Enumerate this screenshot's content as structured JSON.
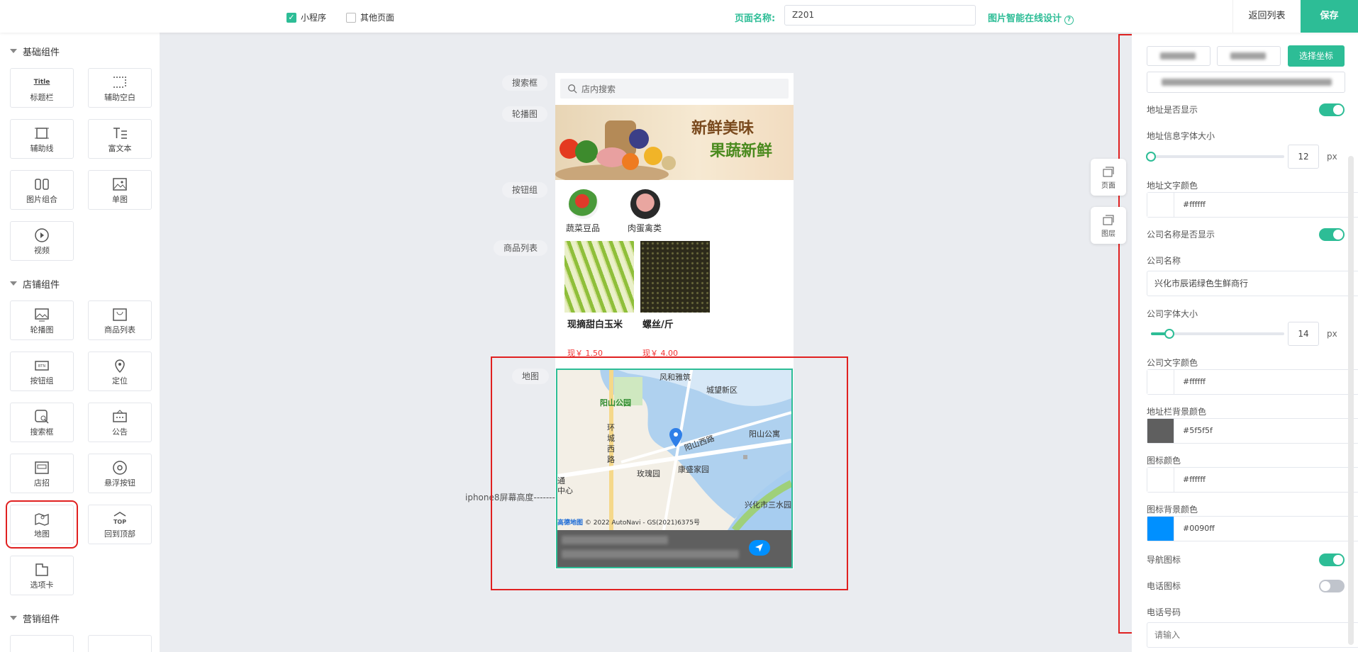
{
  "topbar": {
    "miniprogram_label": "小程序",
    "other_pages_label": "其他页面",
    "page_name_label": "页面名称:",
    "page_name_value": "Z201",
    "ai_design_link": "图片智能在线设计",
    "back_to_list": "返回列表",
    "save": "保存"
  },
  "left_panel": {
    "basic_title": "基础组件",
    "basic_items": [
      {
        "label": "标题栏",
        "icon": "title-icon",
        "icon_text": "Title"
      },
      {
        "label": "辅助空白",
        "icon": "blank-icon"
      },
      {
        "label": "辅助线",
        "icon": "line-icon"
      },
      {
        "label": "富文本",
        "icon": "richtext-icon"
      },
      {
        "label": "图片组合",
        "icon": "image-group-icon"
      },
      {
        "label": "单图",
        "icon": "image-icon"
      },
      {
        "label": "视频",
        "icon": "video-icon"
      }
    ],
    "shop_title": "店铺组件",
    "shop_items": [
      {
        "label": "轮播图",
        "icon": "carousel-icon"
      },
      {
        "label": "商品列表",
        "icon": "goods-list-icon"
      },
      {
        "label": "按钮组",
        "icon": "button-group-icon"
      },
      {
        "label": "定位",
        "icon": "location-icon"
      },
      {
        "label": "搜索框",
        "icon": "search-box-icon"
      },
      {
        "label": "公告",
        "icon": "notice-icon"
      },
      {
        "label": "店招",
        "icon": "shop-sign-icon"
      },
      {
        "label": "悬浮按钮",
        "icon": "float-button-icon"
      },
      {
        "label": "地图",
        "icon": "map-icon"
      },
      {
        "label": "回到顶部",
        "icon": "back-top-icon"
      },
      {
        "label": "选项卡",
        "icon": "tabs-icon"
      }
    ],
    "marketing_title": "营销组件"
  },
  "canvas": {
    "row_labels": {
      "search": "搜索框",
      "carousel": "轮播图",
      "buttons": "按钮组",
      "goods": "商品列表",
      "map": "地图"
    },
    "iphone_marker": "iphone8屏幕高度",
    "search_placeholder": "店内搜索",
    "banner_text_1": "新鲜美味",
    "banner_text_2": "果蔬新鲜",
    "buttons": [
      "蔬菜豆品",
      "肉蛋禽类"
    ],
    "goods": [
      {
        "name": "现摘甜白玉米",
        "price": "现￥ 1.50"
      },
      {
        "name": "螺丝/斤",
        "price": "现￥ 4.00"
      }
    ],
    "map_labels": {
      "fenghe": "风和雅筑",
      "chengwang": "城望新区",
      "yangshan_park": "阳山公园",
      "yangshan_apt": "阳山公寓",
      "huancheng1": "环",
      "huancheng2": "城",
      "huancheng3": "西",
      "huancheng4": "路",
      "yangshan_west": "阳山西路",
      "meigui": "玫瑰园",
      "kangsheng": "康盛家园",
      "xinghua": "兴化市三水园",
      "tong": "通",
      "zhongxin": "中心",
      "attribution": "© 2022 AutoNavi - GS(2021)6375号",
      "gaode": "高德地图"
    }
  },
  "side_tabs": {
    "page": "页面",
    "layer": "图层"
  },
  "right_panel": {
    "choose_coord": "选择坐标",
    "addr_show": "地址是否显示",
    "addr_font_size": "地址信息字体大小",
    "addr_font_value": "12",
    "unit": "px",
    "addr_text_color": "地址文字颜色",
    "addr_text_color_value": "#ffffff",
    "company_show": "公司名称是否显示",
    "company_name_label": "公司名称",
    "company_name_value": "兴化市辰诺绿色生鲜商行",
    "company_font_size": "公司字体大小",
    "company_font_value": "14",
    "company_text_color": "公司文字颜色",
    "company_text_color_value": "#ffffff",
    "addr_bg_color": "地址栏背景颜色",
    "addr_bg_color_value": "#5f5f5f",
    "icon_color": "图标颜色",
    "icon_color_value": "#ffffff",
    "icon_bg_color": "图标背景颜色",
    "icon_bg_color_value": "#0090ff",
    "nav_icon": "导航图标",
    "phone_icon": "电话图标",
    "phone_number": "电话号码",
    "phone_placeholder": "请输入",
    "addr_show_on": true,
    "company_show_on": true,
    "nav_icon_on": true,
    "phone_icon_on": false,
    "addr_font_fraction": 0.0,
    "company_font_fraction": 0.14
  },
  "colors": {
    "accent": "#2dbd96",
    "highlight_red": "#e02020",
    "price_red": "#f23030",
    "addr_bar": "#5f5f5f",
    "nav_blue": "#0090ff"
  }
}
